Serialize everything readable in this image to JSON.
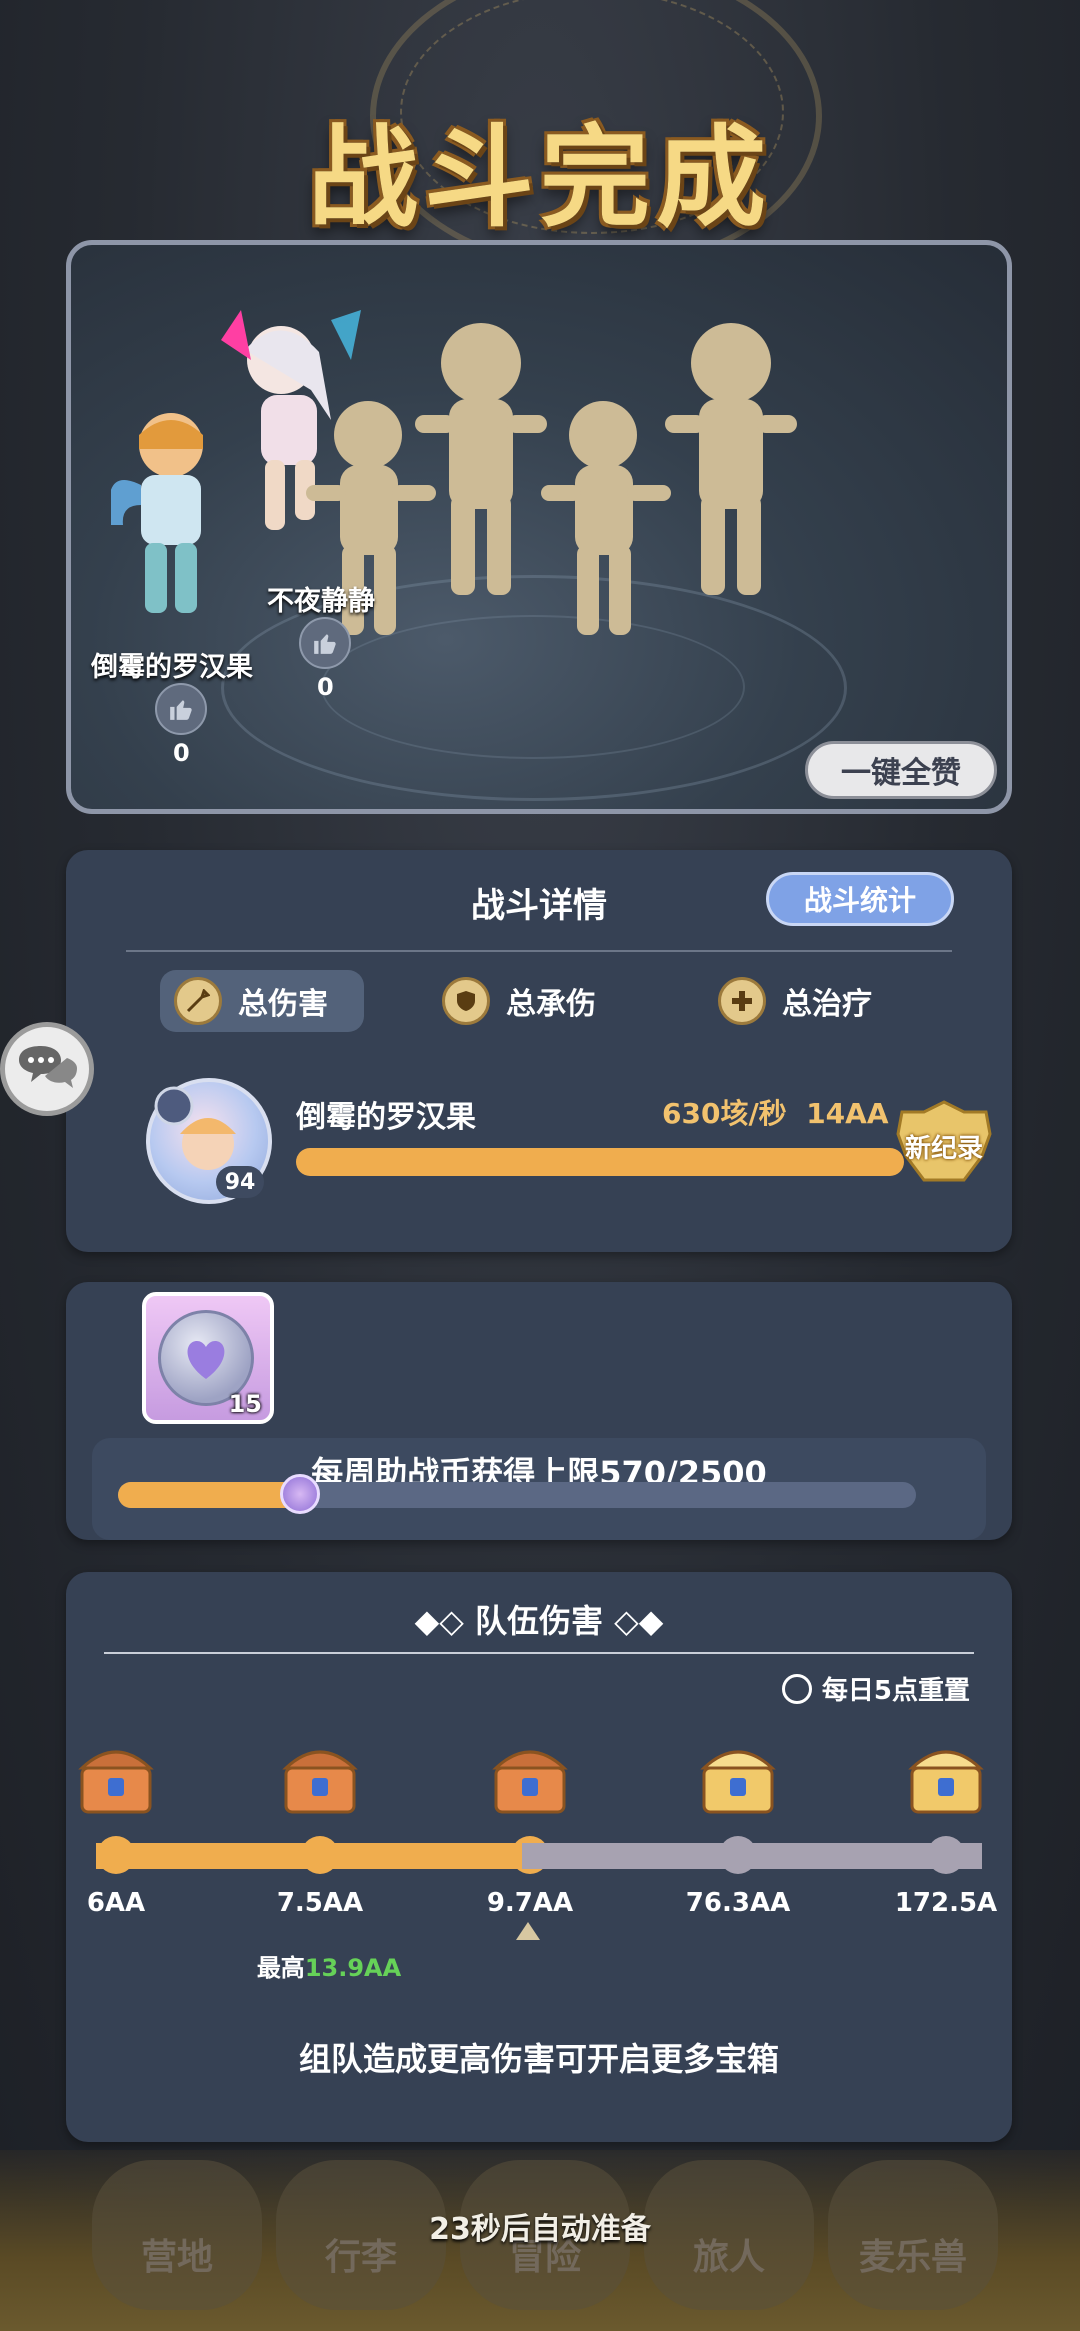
{
  "header": {
    "title": "战斗完成"
  },
  "scene": {
    "players": [
      {
        "name": "倒霉的罗汉果",
        "likes": "0"
      },
      {
        "name": "不夜静静",
        "likes": "0"
      }
    ],
    "like_all_label": "一键全赞"
  },
  "battle_details": {
    "title": "战斗详情",
    "stats_button": "战斗统计",
    "tabs": [
      {
        "label": "总伤害",
        "icon": "sword-icon",
        "active": true
      },
      {
        "label": "总承伤",
        "icon": "shield-icon",
        "active": false
      },
      {
        "label": "总治疗",
        "icon": "heal-cross-icon",
        "active": false
      }
    ],
    "player": {
      "name": "倒霉的罗汉果",
      "level": "94",
      "dps": "630垓/秒",
      "total": "14AA",
      "badge": "新纪录",
      "bar_fraction": 1.0
    }
  },
  "assist_coin": {
    "item_count": "15",
    "limit_text": "每周助战币获得上限570/2500",
    "progress": 0.228
  },
  "team_damage": {
    "title": "队伍伤害",
    "reset_text": "每日5点重置",
    "milestones": [
      {
        "label": "6AA",
        "chest": "bronze",
        "reached": true
      },
      {
        "label": "7.5AA",
        "chest": "bronze",
        "reached": true
      },
      {
        "label": "9.7AA",
        "chest": "bronze",
        "reached": true
      },
      {
        "label": "76.3AA",
        "chest": "gold",
        "reached": false
      },
      {
        "label": "172.5A",
        "chest": "gold",
        "reached": false
      }
    ],
    "max_prefix": "最高",
    "max_value": "13.9AA",
    "hint": "组队造成更高伤害可开启更多宝箱"
  },
  "bottom_nav": {
    "items": [
      "营地",
      "行李",
      "冒险",
      "旅人",
      "麦乐兽"
    ],
    "auto_ready": "23秒后自动准备"
  },
  "colors": {
    "accent_orange": "#f0ad4e",
    "title_gold": "#f6d985",
    "panel": "#364154",
    "max_green": "#66d158"
  }
}
